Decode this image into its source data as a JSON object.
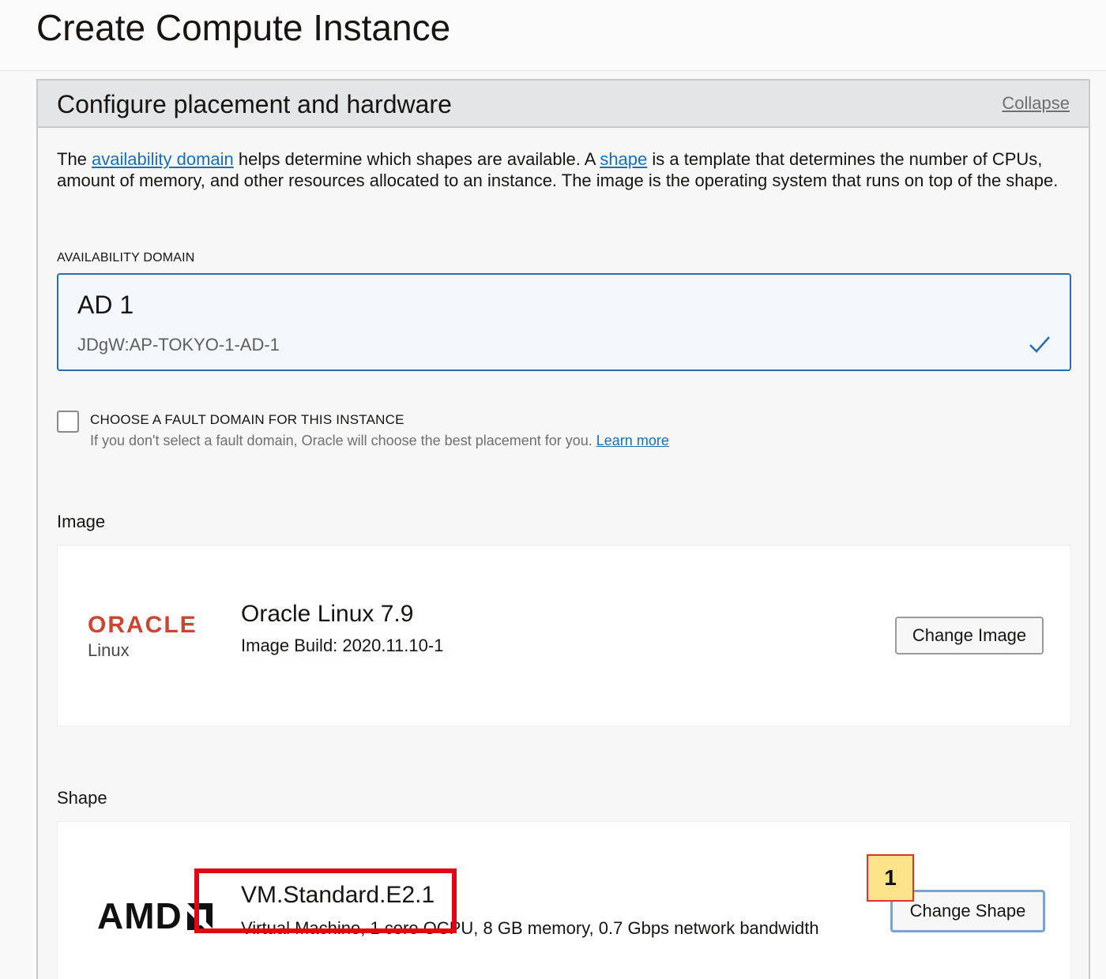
{
  "page": {
    "title": "Create Compute Instance"
  },
  "panel": {
    "title": "Configure placement and hardware",
    "collapse_label": "Collapse",
    "intro": {
      "part1": "The ",
      "link1": "availability domain",
      "part2": " helps determine which shapes are available. A ",
      "link2": "shape",
      "part3": " is a template that determines the number of CPUs, amount of memory, and other resources allocated to an instance. The image is the operating system that runs on top of the shape."
    }
  },
  "availability_domain": {
    "label": "AVAILABILITY DOMAIN",
    "selected_name": "AD 1",
    "selected_id": "JDgW:AP-TOKYO-1-AD-1"
  },
  "fault_domain": {
    "title": "CHOOSE A FAULT DOMAIN FOR THIS INSTANCE",
    "help": "If you don't select a fault domain, Oracle will choose the best placement for you. ",
    "learn_more": "Learn more",
    "checked": false
  },
  "image": {
    "section_label": "Image",
    "logo_word": "ORACLE",
    "logo_sub": "Linux",
    "name": "Oracle Linux 7.9",
    "build": "Image Build: 2020.11.10-1",
    "change_button": "Change Image"
  },
  "shape": {
    "section_label": "Shape",
    "logo_word": "AMD",
    "name": "VM.Standard.E2.1",
    "description": "Virtual Machine, 1 core OCPU, 8 GB memory, 0.7 Gbps network bandwidth",
    "change_button": "Change Shape"
  },
  "annotation": {
    "badge_number": "1",
    "highlight_color": "#e10613",
    "badge_color": "#fde38a"
  },
  "colors": {
    "link": "#1a6eb6",
    "accent_border": "#2b6cb0",
    "oracle_red": "#c74634"
  }
}
